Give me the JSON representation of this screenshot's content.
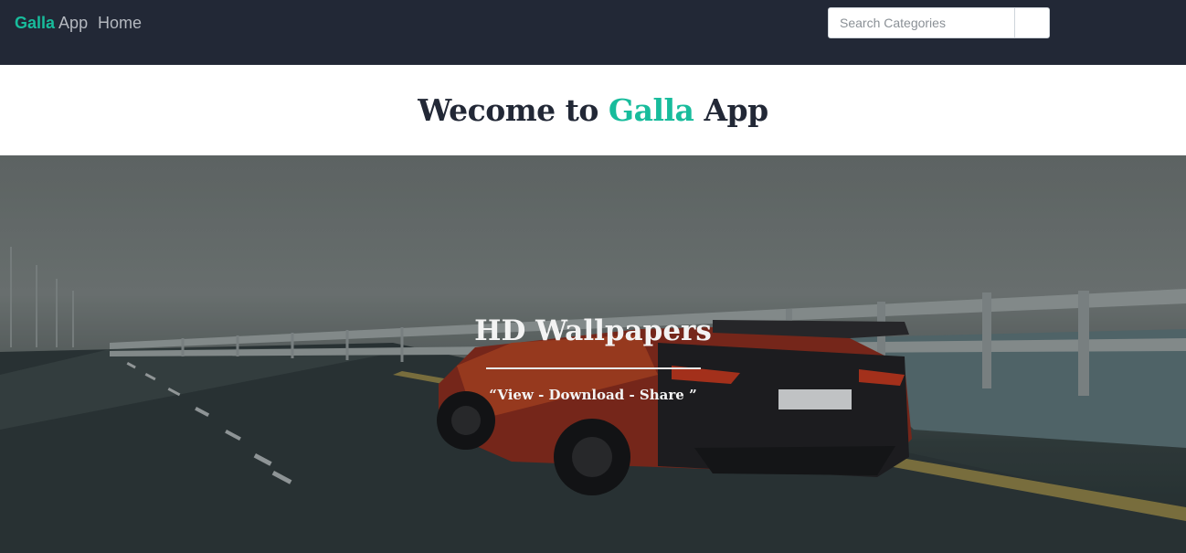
{
  "navbar": {
    "brand_primary": "Galla",
    "brand_secondary": "App",
    "home_label": "Home",
    "search_placeholder": "Search Categories"
  },
  "welcome": {
    "prefix": "Wecome to",
    "accent": "Galla",
    "suffix": "App"
  },
  "hero": {
    "title": "HD Wallpapers",
    "subtitle": "“View - Download - Share ”"
  },
  "colors": {
    "nav_bg": "#222836",
    "accent": "#18bc9c",
    "text_dark": "#222836"
  }
}
